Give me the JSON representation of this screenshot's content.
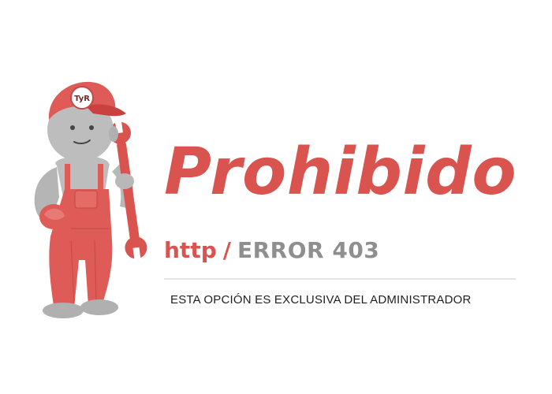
{
  "mascot": {
    "cap_badge_text": "TyR",
    "icon": "mechanic-with-wrench-illustration"
  },
  "page": {
    "title": "Prohibido",
    "error": {
      "protocol": "http",
      "separator": "/",
      "code": "ERROR 403"
    },
    "message": "ESTA OPCIÓN ES EXCLUSIVA DEL ADMINISTRADOR"
  },
  "colors": {
    "brand_red": "#d9534f",
    "grey_text": "#8f8f8f",
    "dark_text": "#1f1f1f",
    "divider": "#e3e3e3"
  }
}
